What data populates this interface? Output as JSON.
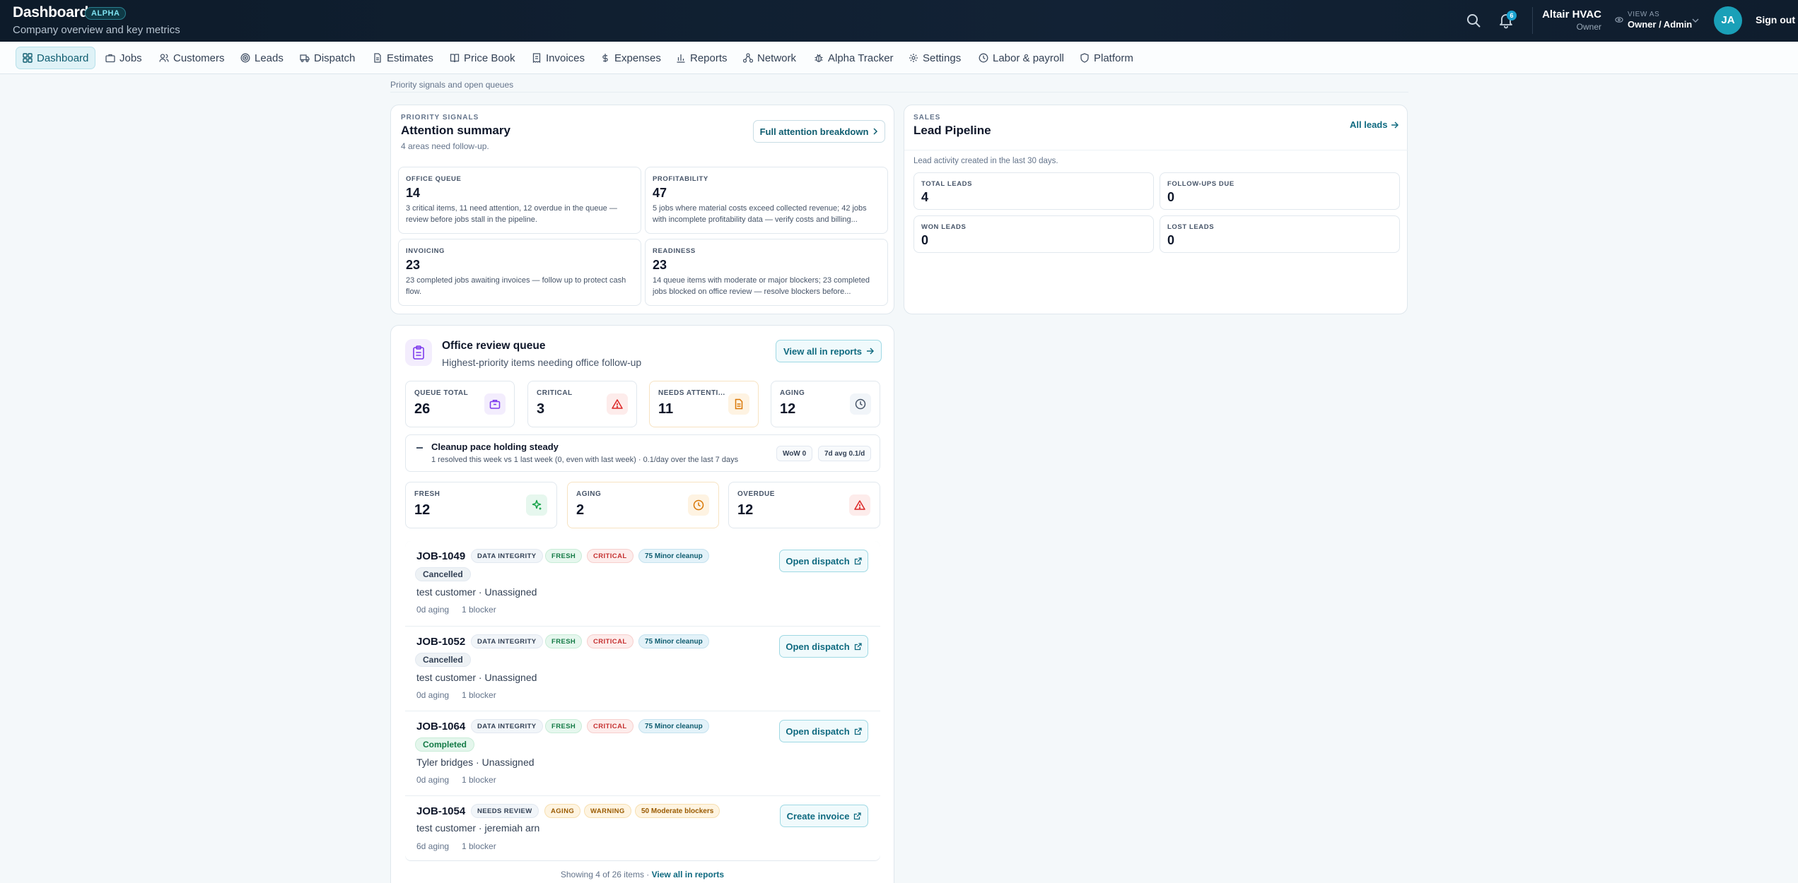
{
  "header": {
    "title": "Dashboard",
    "badge": "ALPHA",
    "subtitle": "Company overview and key metrics",
    "notifications_count": "6",
    "company": "Altair HVAC",
    "company_role": "Owner",
    "view_as_label": "VIEW AS",
    "view_as_value": "Owner / Admin",
    "avatar_initials": "JA",
    "sign_out": "Sign out"
  },
  "nav": {
    "items": [
      {
        "label": "Dashboard",
        "icon": "grid-icon"
      },
      {
        "label": "Jobs",
        "icon": "briefcase-icon"
      },
      {
        "label": "Customers",
        "icon": "users-icon"
      },
      {
        "label": "Leads",
        "icon": "target-icon"
      },
      {
        "label": "Dispatch",
        "icon": "truck-icon"
      },
      {
        "label": "Estimates",
        "icon": "document-icon"
      },
      {
        "label": "Price Book",
        "icon": "book-icon"
      },
      {
        "label": "Invoices",
        "icon": "receipt-icon"
      },
      {
        "label": "Expenses",
        "icon": "dollar-icon"
      },
      {
        "label": "Reports",
        "icon": "bar-chart-icon"
      },
      {
        "label": "Network",
        "icon": "network-icon"
      },
      {
        "label": "Alpha Tracker",
        "icon": "bug-icon"
      },
      {
        "label": "Settings",
        "icon": "gear-icon"
      },
      {
        "label": "Labor & payroll",
        "icon": "clock-icon"
      },
      {
        "label": "Platform",
        "icon": "shield-icon"
      }
    ]
  },
  "section_subtitle": "Priority signals and open queues",
  "attention": {
    "eyebrow": "PRIORITY SIGNALS",
    "title": "Attention summary",
    "subtitle": "4 areas need follow-up.",
    "button": "Full attention breakdown",
    "tiles": [
      {
        "label": "OFFICE QUEUE",
        "value": "14",
        "desc": "3 critical items, 11 need attention, 12 overdue in the queue — review before jobs stall in the pipeline."
      },
      {
        "label": "PROFITABILITY",
        "value": "47",
        "desc": "5 jobs where material costs exceed collected revenue; 42 jobs with incomplete profitability data — verify costs and billing..."
      },
      {
        "label": "INVOICING",
        "value": "23",
        "desc": "23 completed jobs awaiting invoices — follow up to protect cash flow."
      },
      {
        "label": "READINESS",
        "value": "23",
        "desc": "14 queue items with moderate or major blockers; 23 completed jobs blocked on office review — resolve blockers before..."
      }
    ]
  },
  "leads": {
    "eyebrow": "SALES",
    "title": "Lead Pipeline",
    "link": "All leads",
    "subtitle": "Lead activity created in the last 30 days.",
    "tiles": [
      {
        "label": "TOTAL LEADS",
        "value": "4"
      },
      {
        "label": "FOLLOW-UPS DUE",
        "value": "0"
      },
      {
        "label": "WON LEADS",
        "value": "0"
      },
      {
        "label": "LOST LEADS",
        "value": "0"
      }
    ]
  },
  "queue": {
    "title": "Office review queue",
    "subtitle": "Highest-priority items needing office follow-up",
    "button": "View all in reports",
    "stats": [
      {
        "label": "QUEUE TOTAL",
        "value": "26",
        "icon": "briefcase-icon",
        "color": "#7c3aed"
      },
      {
        "label": "CRITICAL",
        "value": "3",
        "icon": "alert-triangle-icon",
        "color": "#dc2626"
      },
      {
        "label": "NEEDS ATTENTI...",
        "value": "11",
        "icon": "document-icon",
        "color": "#d97706"
      },
      {
        "label": "AGING",
        "value": "12",
        "icon": "clock-icon",
        "color": "#475569"
      }
    ],
    "pace": {
      "title": "Cleanup pace holding steady",
      "desc": "1 resolved this week vs 1 last week (0, even with last week) · 0.1/day over the last 7 days",
      "wow": "WoW 0",
      "avg": "7d avg 0.1/d"
    },
    "age_stats": [
      {
        "label": "FRESH",
        "value": "12",
        "icon": "sparkle-icon",
        "color": "#16a34a"
      },
      {
        "label": "AGING",
        "value": "2",
        "icon": "clock-icon",
        "color": "#d97706"
      },
      {
        "label": "OVERDUE",
        "value": "12",
        "icon": "alert-triangle-icon",
        "color": "#dc2626"
      }
    ],
    "jobs": [
      {
        "id": "JOB-1049",
        "tags": [
          "DATA INTEGRITY",
          "FRESH",
          "CRITICAL",
          "75 Minor cleanup"
        ],
        "status": "Cancelled",
        "customer": "test customer · Unassigned",
        "aging": "0d aging",
        "blockers": "1 blocker",
        "action": "Open dispatch"
      },
      {
        "id": "JOB-1052",
        "tags": [
          "DATA INTEGRITY",
          "FRESH",
          "CRITICAL",
          "75 Minor cleanup"
        ],
        "status": "Cancelled",
        "customer": "test customer · Unassigned",
        "aging": "0d aging",
        "blockers": "1 blocker",
        "action": "Open dispatch"
      },
      {
        "id": "JOB-1064",
        "tags": [
          "DATA INTEGRITY",
          "FRESH",
          "CRITICAL",
          "75 Minor cleanup"
        ],
        "status": "Completed",
        "customer": "Tyler bridges · Unassigned",
        "aging": "0d aging",
        "blockers": "1 blocker",
        "action": "Open dispatch"
      },
      {
        "id": "JOB-1054",
        "tags": [
          "NEEDS REVIEW",
          "AGING",
          "WARNING",
          "50 Moderate blockers"
        ],
        "status": "",
        "customer": "test customer · jeremiah arn",
        "aging": "6d aging",
        "blockers": "1 blocker",
        "action": "Create invoice"
      }
    ],
    "footer_text": "Showing 4 of 26 items ·",
    "footer_link": "View all in reports"
  }
}
